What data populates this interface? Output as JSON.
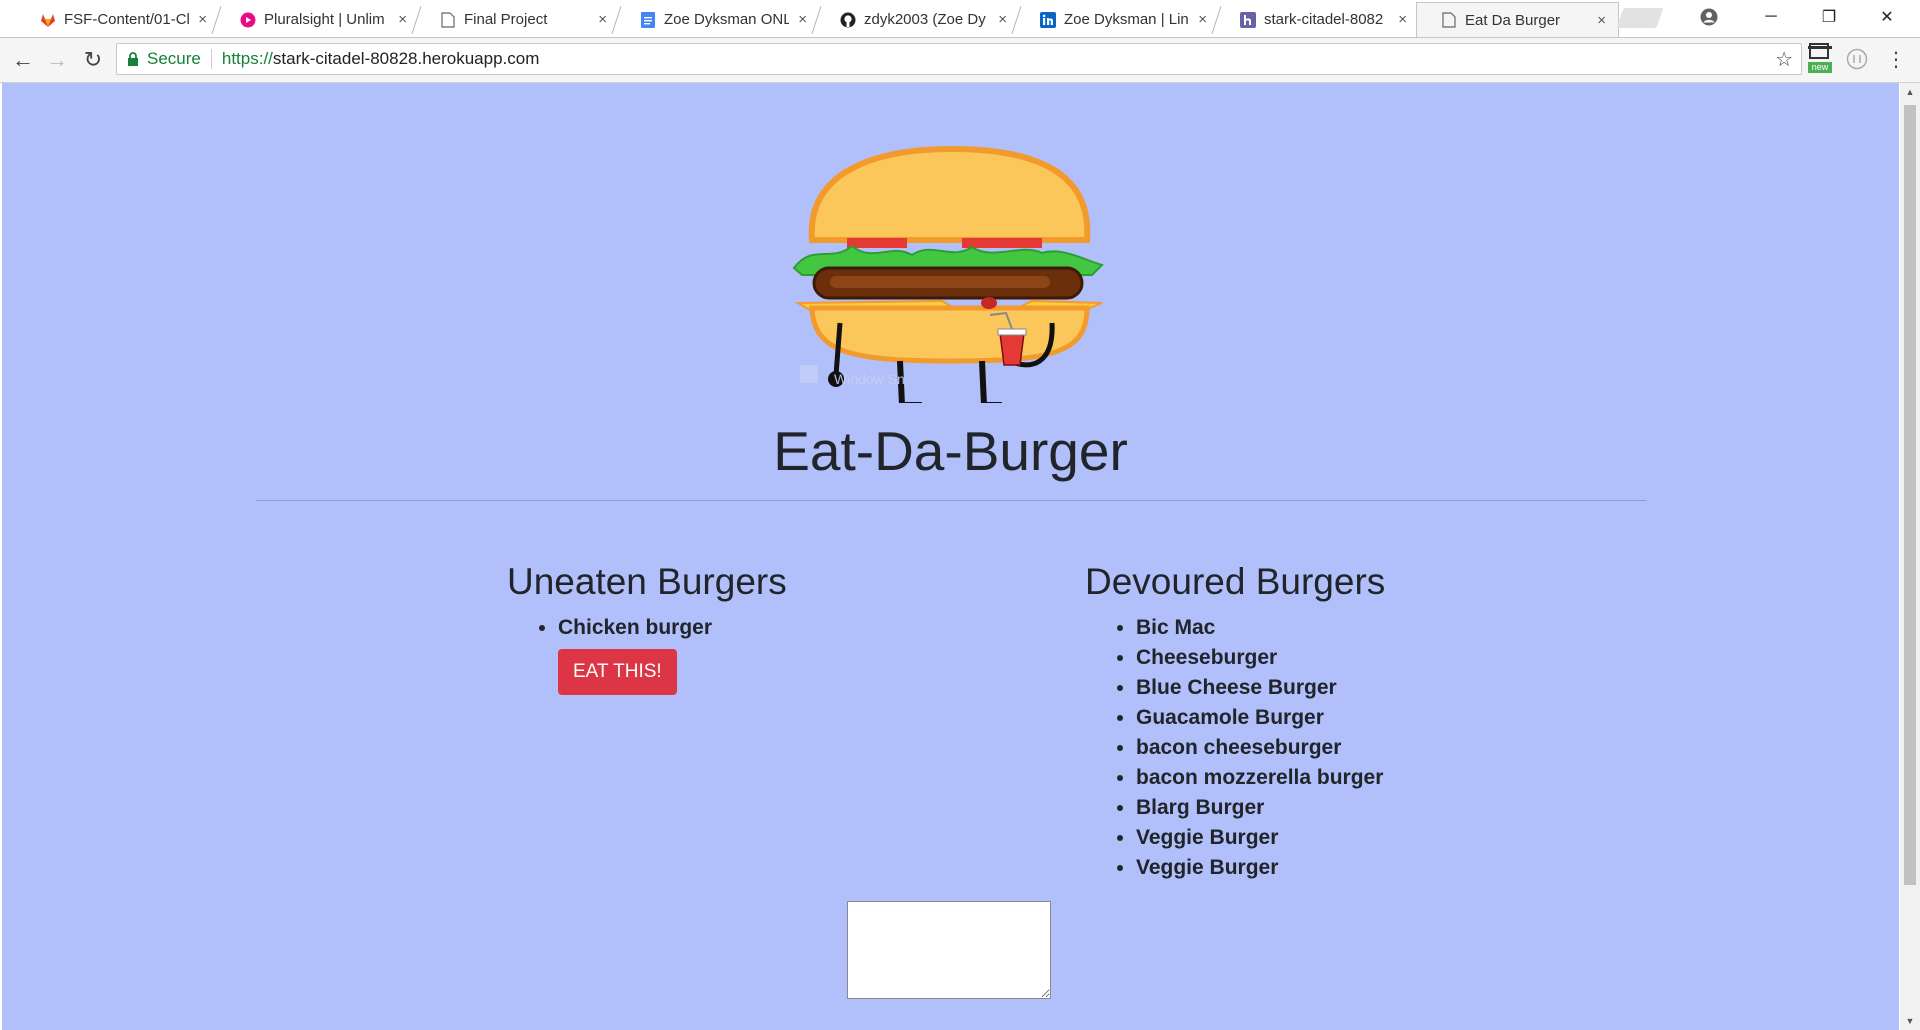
{
  "browser": {
    "tabs": [
      {
        "title": "FSF-Content/01-Cl",
        "icon": "gitlab-icon",
        "active": false
      },
      {
        "title": "Pluralsight | Unlim",
        "icon": "pluralsight-icon",
        "active": false
      },
      {
        "title": "Final Project",
        "icon": "page-icon",
        "active": false
      },
      {
        "title": "Zoe Dyksman ONL",
        "icon": "docs-icon",
        "active": false
      },
      {
        "title": "zdyk2003 (Zoe Dy",
        "icon": "github-icon",
        "active": false
      },
      {
        "title": "Zoe Dyksman | Lin",
        "icon": "linkedin-icon",
        "active": false
      },
      {
        "title": "stark-citadel-8082",
        "icon": "heroku-icon",
        "active": false
      },
      {
        "title": "Eat Da Burger",
        "icon": "page-icon",
        "active": true
      }
    ],
    "tab_close": "×",
    "window": {
      "minimize": "─",
      "restore": "❐",
      "close": "✕"
    },
    "address": {
      "secure_label": "Secure",
      "url_scheme": "https://",
      "url_host": "stark-citadel-80828.herokuapp.com"
    },
    "extension_badge": "new"
  },
  "page": {
    "title": "Eat-Da-Burger",
    "image_watermark": "Window Sn",
    "uneaten": {
      "heading": "Uneaten Burgers",
      "items": [
        "Chicken burger"
      ],
      "button_label": "EAT THIS!"
    },
    "devoured": {
      "heading": "Devoured Burgers",
      "items": [
        "Bic Mac",
        "Cheeseburger",
        "Blue Cheese Burger",
        "Guacamole Burger",
        "bacon cheeseburger",
        "bacon mozzerella burger",
        "Blarg Burger",
        "Veggie Burger",
        "Veggie Burger"
      ]
    },
    "textarea_value": ""
  },
  "colors": {
    "page_background": "#b1bffb",
    "eat_button": "#dc3545",
    "secure_green": "#188038"
  }
}
